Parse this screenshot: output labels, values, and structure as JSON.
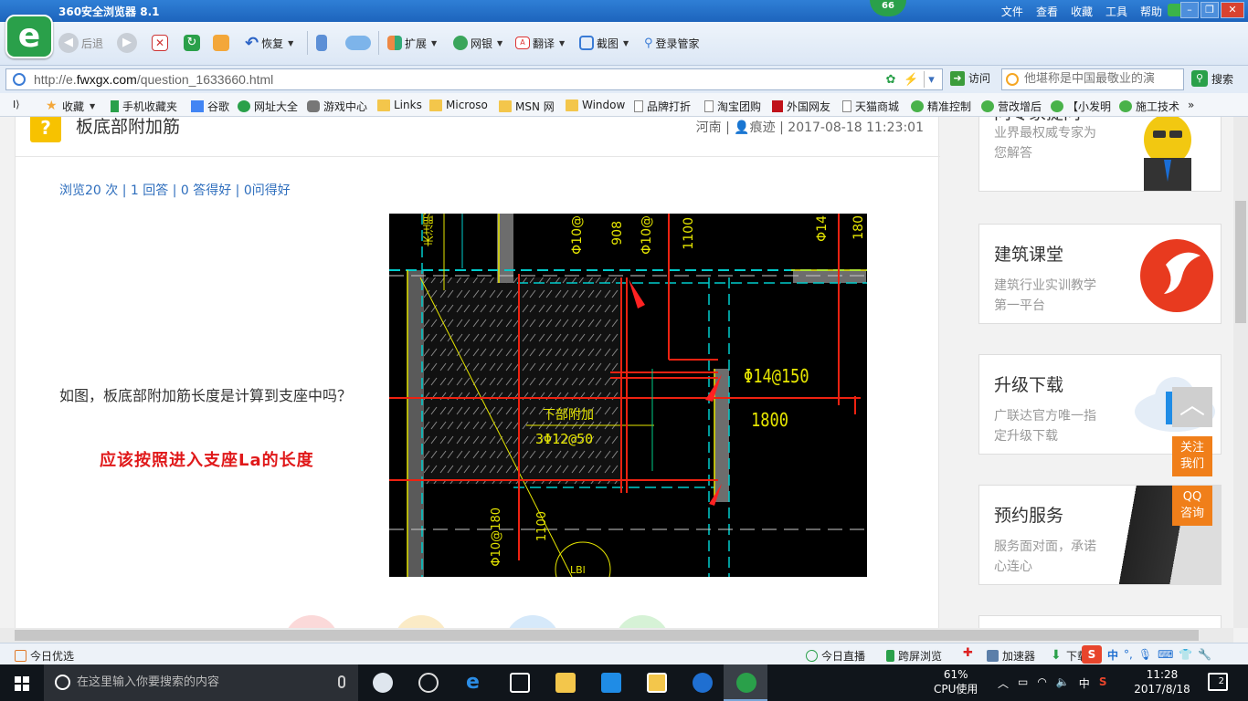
{
  "browser": {
    "title": "360安全浏览器 8.1",
    "badge": "66",
    "menu": [
      "文件",
      "查看",
      "收藏",
      "工具",
      "帮助"
    ],
    "toolbar": {
      "back": "后退",
      "restore": "恢复",
      "extend": "扩展",
      "bank": "网银",
      "translate": "翻译",
      "screenshot": "截图",
      "login_manager": "登录管家"
    },
    "address": {
      "prefix": "http://e.",
      "domain": "fwxgx.com",
      "path": "/question_1633660.html"
    },
    "visit": "访问",
    "search_placeholder": "他堪称是中国最敬业的演",
    "search_button": "搜索",
    "favorites": [
      "收藏",
      "手机收藏夹",
      "谷歌",
      "网址大全",
      "游戏中心",
      "Links",
      "Microso",
      "MSN 网",
      "Window",
      "品牌打折",
      "淘宝团购",
      "外国网友",
      "天猫商城",
      "精准控制",
      "营改增后",
      "【小发明",
      "施工技术"
    ]
  },
  "question": {
    "title": "板底部附加筋",
    "region": "河南",
    "author": "痕迹",
    "datetime": "2017-08-18 11:23:01",
    "stats": "浏览20 次 | 1 回答 | 0 答得好 | 0问得好",
    "text": "如图，板底部附加筋长度是计算到支座中吗？",
    "answer": "应该按照进入支座La的长度"
  },
  "cad": {
    "labels": {
      "top1": "未注明",
      "top2": "Φ10@",
      "top3": "908",
      "top4": "Φ10@",
      "top5": "1100",
      "top6": "Φ14",
      "top7": "180",
      "rebar": "Φ14@150",
      "dim": "1800",
      "note1": "下部附加",
      "note2": "3Φ12@50",
      "bottom1": "Φ10@180",
      "bottom2": "1100",
      "bottom3": "LBl"
    }
  },
  "sidebar": {
    "expert": {
      "title": "问专家提问",
      "desc": "业界最权威专家为您解答"
    },
    "course": {
      "title": "建筑课堂",
      "desc": "建筑行业实训教学第一平台"
    },
    "upgrade": {
      "title": "升级下载",
      "desc": "广联达官方唯一指定升级下载"
    },
    "booking": {
      "title": "预约服务",
      "desc": "服务面对面，承诺心连心"
    },
    "follow": "关注我们",
    "qq": "QQ咨询"
  },
  "statusbar": {
    "today": "今日优选",
    "live": "今日直播",
    "cross": "跨屏浏览",
    "accelerator": "加速器",
    "download": "下载"
  },
  "taskbar": {
    "search_placeholder": "在这里输入你要搜索的内容",
    "cpu_percent": "61%",
    "cpu_label": "CPU使用",
    "ime": "中",
    "time": "11:28",
    "date": "2017/8/18",
    "notifications": "2"
  }
}
